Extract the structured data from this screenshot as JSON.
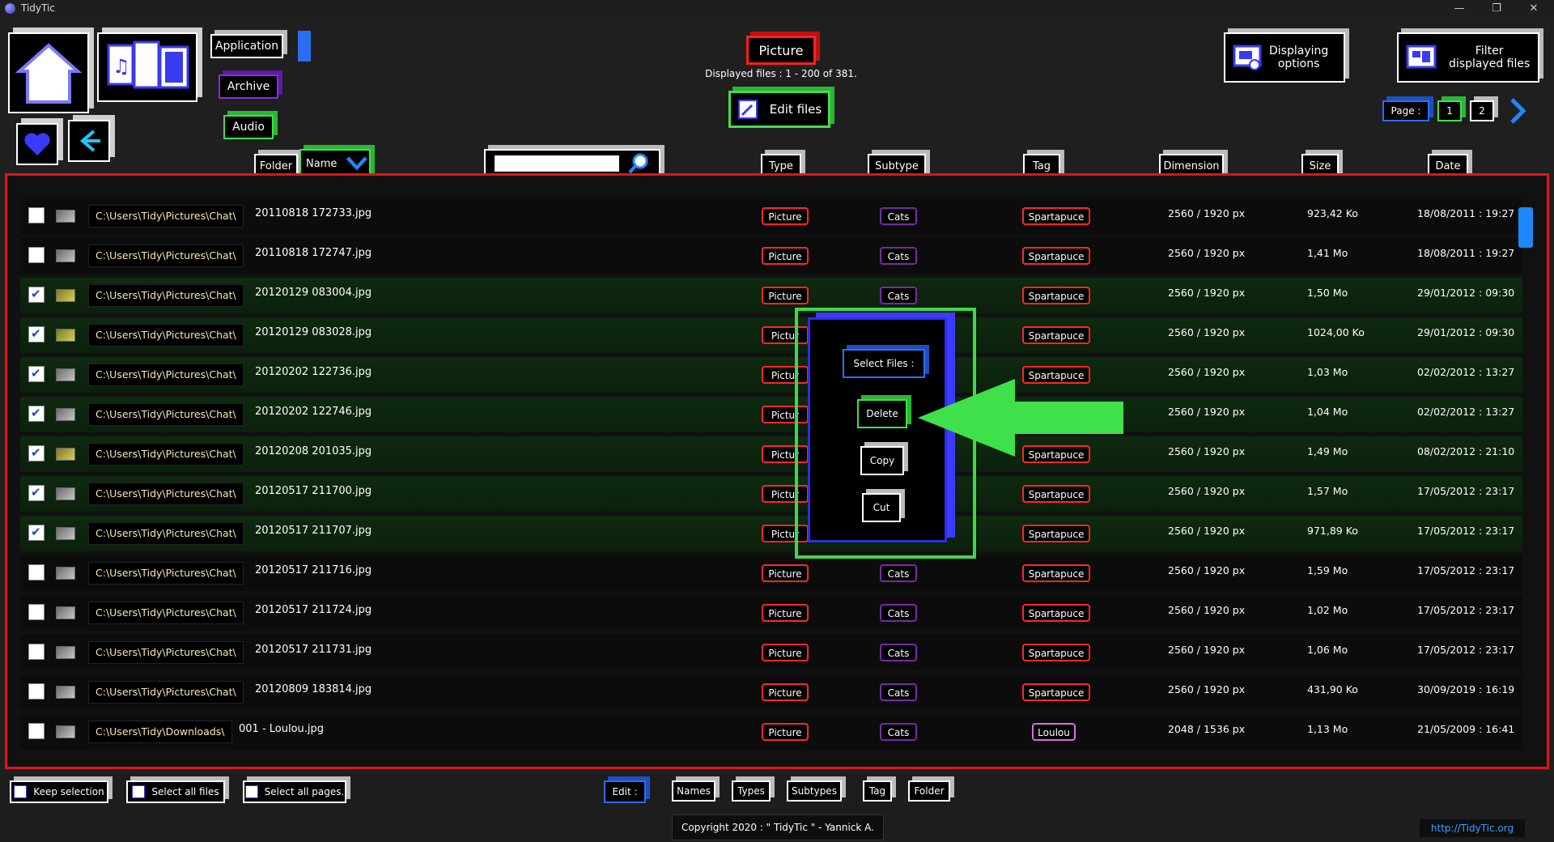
{
  "window": {
    "title": "TidyTic",
    "minimize": "—",
    "restore": "❐",
    "close": "✕"
  },
  "nav": {
    "application": "Application",
    "archive": "Archive",
    "audio": "Audio",
    "picture": "Picture",
    "displayed_files": "Displayed files : 1 - 200 of 381.",
    "edit_files": "Edit files",
    "displaying_options": "Displaying\noptions",
    "filter_displayed_files": "Filter\ndisplayed files",
    "page_label": "Page :",
    "pages": [
      "1",
      "2"
    ]
  },
  "columns": {
    "folder": "Folder",
    "name": "Name",
    "type": "Type",
    "subtype": "Subtype",
    "tag": "Tag",
    "dimension": "Dimension",
    "size": "Size",
    "date": "Date"
  },
  "search": {
    "value": ""
  },
  "rows": [
    {
      "checked": false,
      "thumb": "grey",
      "path": "C:\\Users\\Tidy\\Pictures\\Chat\\",
      "name": "20110818 172733.jpg",
      "type": "Picture",
      "subtype": "Cats",
      "tag": "Spartapuce",
      "dimension": "2560 / 1920 px",
      "size": "923,42 Ko",
      "date": "18/08/2011 : 19:27"
    },
    {
      "checked": false,
      "thumb": "grey",
      "path": "C:\\Users\\Tidy\\Pictures\\Chat\\",
      "name": "20110818 172747.jpg",
      "type": "Picture",
      "subtype": "Cats",
      "tag": "Spartapuce",
      "dimension": "2560 / 1920 px",
      "size": "1,41 Mo",
      "date": "18/08/2011 : 19:27"
    },
    {
      "checked": true,
      "thumb": "yellow",
      "path": "C:\\Users\\Tidy\\Pictures\\Chat\\",
      "name": "20120129 083004.jpg",
      "type": "Picture",
      "subtype": "Cats",
      "tag": "Spartapuce",
      "dimension": "2560 / 1920 px",
      "size": "1,50 Mo",
      "date": "29/01/2012 : 09:30"
    },
    {
      "checked": true,
      "thumb": "yellow",
      "path": "C:\\Users\\Tidy\\Pictures\\Chat\\",
      "name": "20120129 083028.jpg",
      "type": "Pictur",
      "subtype": "",
      "tag": "Spartapuce",
      "dimension": "2560 / 1920 px",
      "size": "1024,00 Ko",
      "date": "29/01/2012 : 09:30"
    },
    {
      "checked": true,
      "thumb": "grey",
      "path": "C:\\Users\\Tidy\\Pictures\\Chat\\",
      "name": "20120202 122736.jpg",
      "type": "Pictur",
      "subtype": "",
      "tag": "Spartapuce",
      "dimension": "2560 / 1920 px",
      "size": "1,03 Mo",
      "date": "02/02/2012 : 13:27"
    },
    {
      "checked": true,
      "thumb": "grey",
      "path": "C:\\Users\\Tidy\\Pictures\\Chat\\",
      "name": "20120202 122746.jpg",
      "type": "Pictur",
      "subtype": "",
      "tag": "",
      "dimension": "2560 / 1920 px",
      "size": "1,04 Mo",
      "date": "02/02/2012 : 13:27"
    },
    {
      "checked": true,
      "thumb": "yellow",
      "path": "C:\\Users\\Tidy\\Pictures\\Chat\\",
      "name": "20120208 201035.jpg",
      "type": "Pictur",
      "subtype": "",
      "tag": "Spartapuce",
      "dimension": "2560 / 1920 px",
      "size": "1,49 Mo",
      "date": "08/02/2012 : 21:10"
    },
    {
      "checked": true,
      "thumb": "grey",
      "path": "C:\\Users\\Tidy\\Pictures\\Chat\\",
      "name": "20120517 211700.jpg",
      "type": "Pictur",
      "subtype": "",
      "tag": "Spartapuce",
      "dimension": "2560 / 1920 px",
      "size": "1,57 Mo",
      "date": "17/05/2012 : 23:17"
    },
    {
      "checked": true,
      "thumb": "grey",
      "path": "C:\\Users\\Tidy\\Pictures\\Chat\\",
      "name": "20120517 211707.jpg",
      "type": "Pictur",
      "subtype": "",
      "tag": "Spartapuce",
      "dimension": "2560 / 1920 px",
      "size": "971,89 Ko",
      "date": "17/05/2012 : 23:17"
    },
    {
      "checked": false,
      "thumb": "grey",
      "path": "C:\\Users\\Tidy\\Pictures\\Chat\\",
      "name": "20120517 211716.jpg",
      "type": "Picture",
      "subtype": "Cats",
      "tag": "Spartapuce",
      "dimension": "2560 / 1920 px",
      "size": "1,59 Mo",
      "date": "17/05/2012 : 23:17"
    },
    {
      "checked": false,
      "thumb": "grey",
      "path": "C:\\Users\\Tidy\\Pictures\\Chat\\",
      "name": "20120517 211724.jpg",
      "type": "Picture",
      "subtype": "Cats",
      "tag": "Spartapuce",
      "dimension": "2560 / 1920 px",
      "size": "1,02 Mo",
      "date": "17/05/2012 : 23:17"
    },
    {
      "checked": false,
      "thumb": "grey",
      "path": "C:\\Users\\Tidy\\Pictures\\Chat\\",
      "name": "20120517 211731.jpg",
      "type": "Picture",
      "subtype": "Cats",
      "tag": "Spartapuce",
      "dimension": "2560 / 1920 px",
      "size": "1,06 Mo",
      "date": "17/05/2012 : 23:17"
    },
    {
      "checked": false,
      "thumb": "grey",
      "path": "C:\\Users\\Tidy\\Pictures\\Chat\\",
      "name": "20120809 183814.jpg",
      "type": "Picture",
      "subtype": "Cats",
      "tag": "Spartapuce",
      "dimension": "2560 / 1920 px",
      "size": "431,90 Ko",
      "date": "30/09/2019 : 16:19"
    },
    {
      "checked": false,
      "thumb": "grey",
      "path": "C:\\Users\\Tidy\\Downloads\\",
      "name": "001 - Loulou.jpg",
      "type": "Picture",
      "subtype": "Cats",
      "tag": "Loulou",
      "dimension": "2048 / 1536 px",
      "size": "1,13 Mo",
      "date": "21/05/2009 : 16:41"
    }
  ],
  "popup": {
    "title": "Select Files :",
    "delete": "Delete",
    "copy": "Copy",
    "cut": "Cut"
  },
  "bottom": {
    "keep_selection": "Keep selection",
    "select_all_files": "Select all files",
    "select_all_pages": "Select all pages.",
    "edit": "Edit :",
    "names": "Names",
    "types": "Types",
    "subtypes": "Subtypes",
    "tag": "Tag",
    "folder": "Folder",
    "copyright": "Copyright 2020 : \" TidyTic \" - Yannick A.",
    "link": "http://TidyTic.org"
  },
  "colors": {
    "accent_red": "#ff2020",
    "accent_green": "#3fe04a",
    "accent_blue": "#2b6ef2",
    "accent_purple": "#8a2be2"
  }
}
